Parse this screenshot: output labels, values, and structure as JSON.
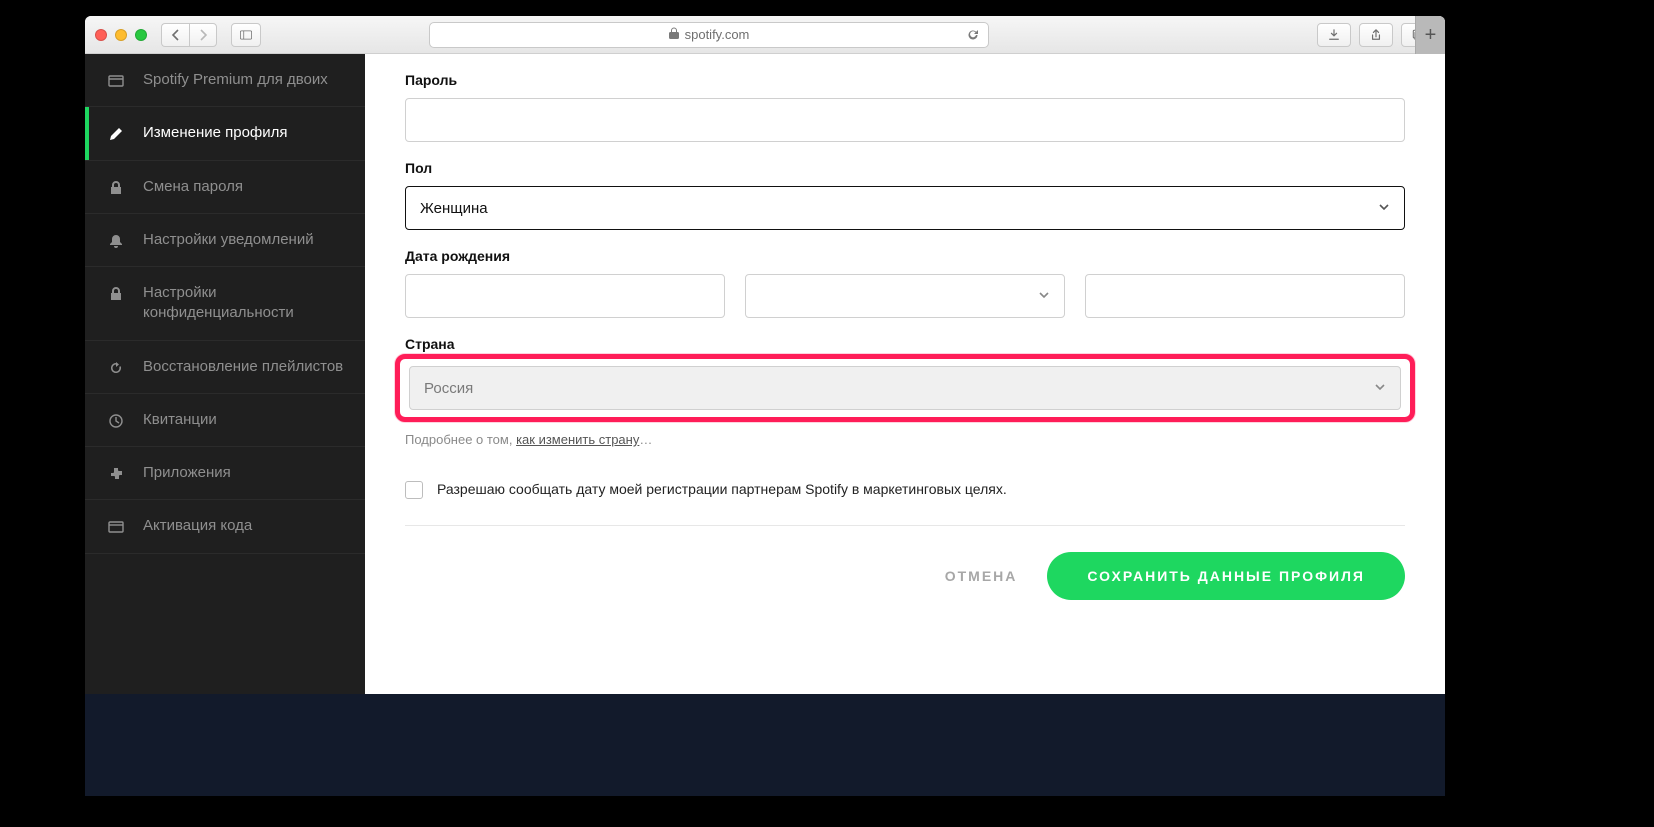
{
  "browser": {
    "url_host": "spotify.com"
  },
  "sidebar": {
    "items": [
      {
        "label": "Spotify Premium для двоих",
        "icon": "card"
      },
      {
        "label": "Изменение профиля",
        "icon": "pencil",
        "active": true
      },
      {
        "label": "Смена пароля",
        "icon": "lock"
      },
      {
        "label": "Настройки уведомлений",
        "icon": "bell"
      },
      {
        "label": "Настройки конфиденциальности",
        "icon": "lock"
      },
      {
        "label": "Восстановление плейлистов",
        "icon": "restore"
      },
      {
        "label": "Квитанции",
        "icon": "clock"
      },
      {
        "label": "Приложения",
        "icon": "puzzle"
      },
      {
        "label": "Активация кода",
        "icon": "card"
      }
    ]
  },
  "form": {
    "password_label": "Пароль",
    "password_value": "",
    "gender_label": "Пол",
    "gender_value": "Женщина",
    "dob_label": "Дата рождения",
    "dob_day": "",
    "dob_month": "",
    "dob_year": "",
    "country_label": "Страна",
    "country_value": "Россия",
    "help_prefix": "Подробнее о том, ",
    "help_link": "как изменить страну",
    "help_suffix": "…",
    "consent_text": "Разрешаю сообщать дату моей регистрации партнерам Spotify в маркетинговых целях.",
    "cancel": "ОТМЕНА",
    "save": "СОХРАНИТЬ ДАННЫЕ ПРОФИЛЯ"
  }
}
